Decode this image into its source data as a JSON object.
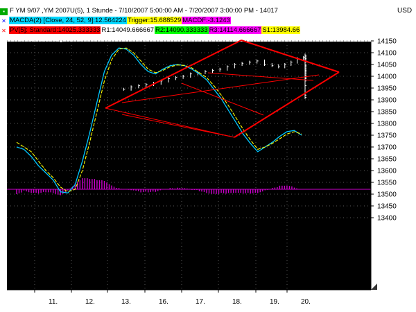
{
  "header": {
    "line1": "F YM 9/07 ,YM 2007U(5), 1 Stunde - 7/10/2007 5:00:00 AM - 7/20/2007 3:00:00 PM - 14017",
    "currency": "USD",
    "line2": {
      "macd": "MACDA(2) [Close, 24, 52, 9]:12.564224",
      "trigger": "Trigger:15.688529",
      "macdf": "MACDF:-3.1243"
    },
    "line3": {
      "pivot": "PV[5]: Standard:14025.333333",
      "r1": "R1:14049.666667",
      "r2": "R2:14090.333333",
      "r3": "R3:14114.666667",
      "s1": "S1:13984.66"
    },
    "watermark": "© www.tradesignal.com"
  },
  "colors": {
    "background": "#000000",
    "price": "#ffffff",
    "macd": "#00c8ff",
    "trigger": "#ffff00",
    "histogram": "#cc00cc",
    "trend_lines": "#ff0000",
    "grid": "#777777"
  },
  "chart_data": {
    "type": "line",
    "y_axis": {
      "ticks": [
        14150,
        14100,
        14050,
        14000,
        13950,
        13900,
        13850,
        13800,
        13750,
        13700,
        13650,
        13600,
        13550,
        13500,
        13450,
        13400
      ],
      "ylim": [
        13360,
        14175
      ]
    },
    "x_axis": {
      "ticks": [
        "11.",
        "12.",
        "13.",
        "16.",
        "17.",
        "18.",
        "19.",
        "20."
      ]
    },
    "price_bars": {
      "x": [
        0.8,
        1.0,
        1.2,
        1.4,
        1.6,
        1.8,
        2.0,
        2.2,
        2.4,
        2.6,
        2.8,
        3.0,
        3.2,
        3.4,
        3.6,
        3.8,
        4.0,
        4.2,
        4.4,
        4.6,
        4.8,
        5.0,
        5.2,
        5.4,
        5.6,
        5.8,
        6.0,
        6.2,
        6.4,
        6.6,
        6.8,
        7.0,
        7.2,
        7.4,
        7.6,
        7.8,
        8.0,
        8.2,
        8.4,
        8.6,
        8.8,
        9.0,
        9.2,
        9.4,
        9.6,
        9.8,
        10.0,
        10.2,
        10.4,
        10.6,
        10.8,
        11.0,
        11.2,
        11.4,
        11.6,
        11.8,
        12.0,
        12.2,
        12.4,
        12.6,
        12.8,
        13.0,
        13.2,
        13.4,
        13.6,
        13.8,
        14.0,
        14.2,
        14.4
      ],
      "close": [
        13945,
        13955,
        13960,
        13965,
        13970,
        13980,
        13990,
        13995,
        14000,
        14010,
        14015,
        14020,
        14025,
        14030,
        14040,
        14050,
        14055,
        14060,
        14065,
        14050,
        14045,
        14040,
        14050,
        14060,
        14075,
        14080,
        14090,
        14085,
        14060,
        14040,
        14020,
        14000,
        13990,
        13995,
        14000,
        14005,
        14010,
        14015,
        14020,
        14030,
        14025,
        13990,
        13960,
        13920,
        13910,
        13930,
        13980,
        14000,
        14010,
        14020,
        14030,
        14035,
        14040,
        14045,
        14050,
        14060,
        14070,
        14080,
        14085,
        14075,
        14070,
        14065,
        14070,
        14075,
        14060,
        14050,
        14040,
        14030,
        14010
      ]
    },
    "macd_series": [
      {
        "name": "MACDA(2)",
        "values": [
          13700,
          13690,
          13660,
          13620,
          13590,
          13560,
          13510,
          13505,
          13540,
          13640,
          13760,
          13890,
          14020,
          14090,
          14120,
          14115,
          14090,
          14050,
          14020,
          14010,
          14030,
          14045,
          14050,
          14045,
          14030,
          14010,
          13985,
          13945,
          13905,
          13855,
          13805,
          13755,
          13715,
          13680,
          13700,
          13720,
          13745,
          13765,
          13770,
          13750
        ]
      },
      {
        "name": "Trigger",
        "values": [
          13720,
          13700,
          13680,
          13640,
          13600,
          13570,
          13530,
          13510,
          13520,
          13600,
          13720,
          13850,
          13980,
          14070,
          14115,
          14120,
          14100,
          14065,
          14030,
          14015,
          14025,
          14040,
          14048,
          14046,
          14035,
          14015,
          13995,
          13960,
          13920,
          13875,
          13825,
          13775,
          13730,
          13690,
          13700,
          13715,
          13735,
          13755,
          13765,
          13755
        ]
      }
    ],
    "trend_lines": [
      "upper-left",
      "upper-right",
      "lower-left",
      "lower-right",
      "inner-diag-1",
      "inner-diag-2"
    ]
  }
}
